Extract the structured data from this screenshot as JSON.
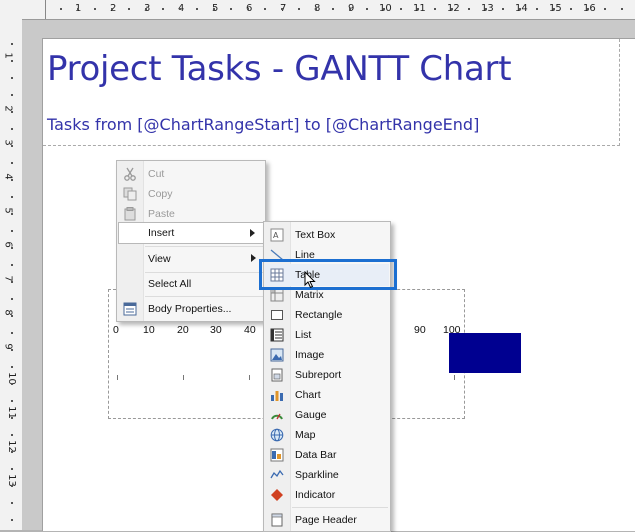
{
  "ruler": {
    "top_numbers": [
      "1",
      "2",
      "3",
      "4",
      "5",
      "6",
      "7",
      "8",
      "9",
      "10",
      "11",
      "12",
      "13",
      "14",
      "15",
      "16"
    ],
    "left_numbers": [
      "1",
      "2",
      "3",
      "4",
      "5",
      "6",
      "7",
      "8",
      "9",
      "10",
      "11",
      "12",
      "13"
    ]
  },
  "report": {
    "title": "Project Tasks - GANTT Chart",
    "subtitle": "Tasks from [@ChartRangeStart] to [@ChartRangeEnd]"
  },
  "chart_data": {
    "type": "bar",
    "x_ticks": [
      "0",
      "10",
      "20",
      "30",
      "40",
      "90",
      "100"
    ],
    "bar_color": "#000090"
  },
  "context_menu": {
    "items": [
      {
        "label": "Cut",
        "icon": "scissors-icon",
        "enabled": false
      },
      {
        "label": "Copy",
        "icon": "copy-icon",
        "enabled": false
      },
      {
        "label": "Paste",
        "icon": "paste-icon",
        "enabled": false
      },
      {
        "label": "Insert",
        "icon": "",
        "enabled": true,
        "submenu": true
      },
      {
        "label": "View",
        "icon": "",
        "enabled": true,
        "submenu": true
      },
      {
        "label": "Select All",
        "icon": "",
        "enabled": true
      },
      {
        "label": "Body Properties...",
        "icon": "properties-icon",
        "enabled": true
      }
    ]
  },
  "insert_submenu": {
    "items": [
      {
        "label": "Text Box",
        "icon": "textbox-icon"
      },
      {
        "label": "Line",
        "icon": "line-icon"
      },
      {
        "label": "Table",
        "icon": "table-icon"
      },
      {
        "label": "Matrix",
        "icon": "matrix-icon"
      },
      {
        "label": "Rectangle",
        "icon": "rectangle-icon"
      },
      {
        "label": "List",
        "icon": "list-icon"
      },
      {
        "label": "Image",
        "icon": "image-icon"
      },
      {
        "label": "Subreport",
        "icon": "subreport-icon"
      },
      {
        "label": "Chart",
        "icon": "chart-icon"
      },
      {
        "label": "Gauge",
        "icon": "gauge-icon"
      },
      {
        "label": "Map",
        "icon": "map-icon"
      },
      {
        "label": "Data Bar",
        "icon": "databar-icon"
      },
      {
        "label": "Sparkline",
        "icon": "sparkline-icon"
      },
      {
        "label": "Indicator",
        "icon": "indicator-icon"
      },
      {
        "label": "Page Header",
        "icon": "page-header-icon"
      }
    ],
    "highlighted": "Table",
    "highlight_color": "#1c6fd1"
  }
}
